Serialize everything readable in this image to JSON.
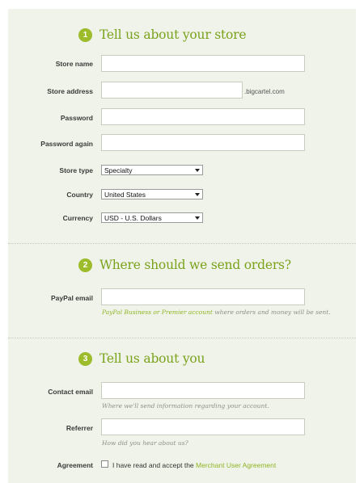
{
  "sections": [
    {
      "number": "1",
      "title": "Tell us about your store"
    },
    {
      "number": "2",
      "title": "Where should we send orders?"
    },
    {
      "number": "3",
      "title": "Tell us about you"
    }
  ],
  "store": {
    "name_label": "Store name",
    "name_value": "",
    "address_label": "Store address",
    "address_value": "",
    "address_suffix": ".bigcartel.com",
    "password_label": "Password",
    "password_again_label": "Password again",
    "type_label": "Store type",
    "type_value": "Specialty",
    "country_label": "Country",
    "country_value": "United States",
    "currency_label": "Currency",
    "currency_value": "USD - U.S. Dollars"
  },
  "orders": {
    "paypal_label": "PayPal email",
    "paypal_value": "",
    "hint_link": "PayPal Business or Premier account",
    "hint_rest": " where orders and money will be sent."
  },
  "about": {
    "contact_label": "Contact email",
    "contact_value": "",
    "contact_hint": "Where we'll send information regarding your account.",
    "referrer_label": "Referrer",
    "referrer_value": "",
    "referrer_hint": "How did you hear about us?",
    "agreement_label": "Agreement",
    "agreement_text": "I have read and accept the ",
    "agreement_link": "Merchant User Agreement",
    "agreement_checked": false
  },
  "colors": {
    "accent": "#7aa21b",
    "badge": "#9cbc2b",
    "panel_bg": "#f0f3e9"
  }
}
